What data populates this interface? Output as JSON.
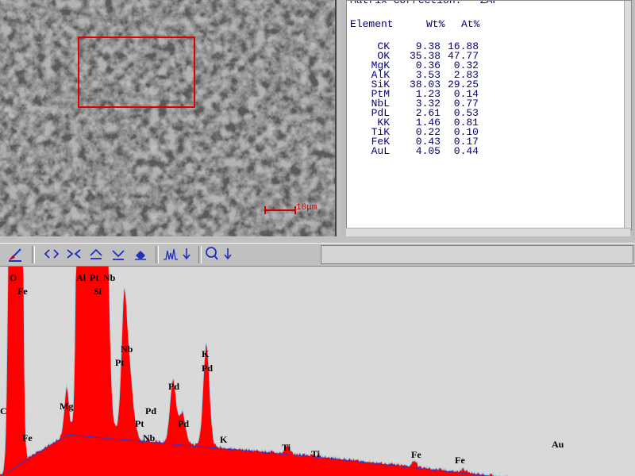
{
  "micrograph": {
    "scale_label": "10μm",
    "selection_color": "#e00000"
  },
  "quant": {
    "title": "Matrix Correction:   ZAF",
    "headers": {
      "element": "Element",
      "wt": "Wt%",
      "at": "At%"
    },
    "rows": [
      {
        "element": "CK",
        "wt": "9.38",
        "at": "16.88"
      },
      {
        "element": "OK",
        "wt": "35.38",
        "at": "47.77"
      },
      {
        "element": "MgK",
        "wt": "0.36",
        "at": "0.32"
      },
      {
        "element": "AlK",
        "wt": "3.53",
        "at": "2.83"
      },
      {
        "element": "SiK",
        "wt": "38.03",
        "at": "29.25"
      },
      {
        "element": "PtM",
        "wt": "1.23",
        "at": "0.14"
      },
      {
        "element": "NbL",
        "wt": "3.32",
        "at": "0.77"
      },
      {
        "element": "PdL",
        "wt": "2.61",
        "at": "0.53"
      },
      {
        "element": "KK",
        "wt": "1.46",
        "at": "0.81"
      },
      {
        "element": "TiK",
        "wt": "0.22",
        "at": "0.10"
      },
      {
        "element": "FeK",
        "wt": "0.43",
        "at": "0.17"
      },
      {
        "element": "AuL",
        "wt": "4.05",
        "at": "0.44"
      }
    ],
    "text_color": "#000080"
  },
  "toolbar": {
    "icons": [
      "broom-icon",
      "expand-horizontal-icon",
      "compress-horizontal-icon",
      "scale-up-icon",
      "scale-down-icon",
      "eraser-icon",
      "peak-label-icon",
      "arrow-down-icon",
      "zoom-icon",
      "arrow-down-icon"
    ]
  },
  "spectrum": {
    "fill_color": "#ff0000",
    "background_line_color": "#3333cc",
    "peak_labels": [
      {
        "text": "O"
      },
      {
        "text": "Fe"
      },
      {
        "text": "Al"
      },
      {
        "text": "Pt"
      },
      {
        "text": "Nb"
      },
      {
        "text": "Si"
      },
      {
        "text": "Nb"
      },
      {
        "text": "Pt"
      },
      {
        "text": "Mg"
      },
      {
        "text": "Pd"
      },
      {
        "text": "Pt"
      },
      {
        "text": "Pd"
      },
      {
        "text": "Nb"
      },
      {
        "text": "K"
      },
      {
        "text": "Pd"
      },
      {
        "text": "Pd"
      },
      {
        "text": "K"
      },
      {
        "text": "C"
      },
      {
        "text": "Fe"
      },
      {
        "text": "Ti"
      },
      {
        "text": "Ti"
      },
      {
        "text": "Fe"
      },
      {
        "text": "Fe"
      },
      {
        "text": "Au"
      }
    ]
  }
}
